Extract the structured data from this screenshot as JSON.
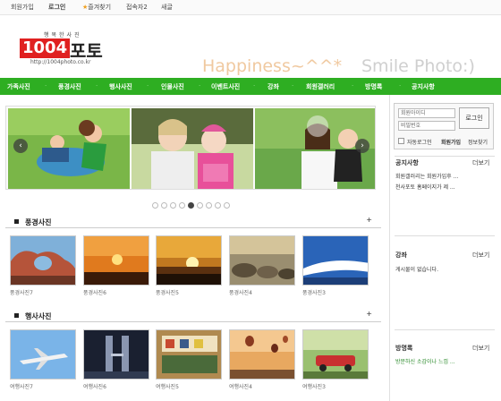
{
  "topbar": {
    "join": "회원가입",
    "login": "로그인",
    "favorites": "즐겨찾기",
    "visitors": "접속자2",
    "menu": "새글"
  },
  "header": {
    "logo_sub": "행복한사진",
    "logo_num": "1004",
    "logo_ko": "포토",
    "logo_url": "http://1004photo.co.kr",
    "slogan1": "Happiness~^^*",
    "slogan2": "Smile Photo:)"
  },
  "nav": [
    "가족사진",
    "풍경사진",
    "행사사진",
    "인물사진",
    "이벤트사진",
    "강좌",
    "회원갤러리",
    "방명록",
    "공지사항"
  ],
  "slider": {
    "prev": "‹",
    "next": "›",
    "dot_count": 9,
    "active_dot": 4
  },
  "sections": {
    "landscape": {
      "title": "풍경사진",
      "more": "+",
      "items": [
        "풍경사진7",
        "풍경사진6",
        "풍경사진5",
        "풍경사진4",
        "풍경사진3"
      ]
    },
    "event": {
      "title": "행사사진",
      "more": "+",
      "items": [
        "여행사진7",
        "여행사진6",
        "여행사진5",
        "여행사진4",
        "여행사진3"
      ]
    }
  },
  "sidebar": {
    "login": {
      "id_placeholder": "회원아이디",
      "pw_placeholder": "비밀번호",
      "button": "로그인",
      "autologin": "자동로그인",
      "join": "회원가입",
      "find": "정보찾기"
    },
    "notice": {
      "title": "공지사항",
      "more": "더보기",
      "items": [
        "회원갤러리는 회원가입후 ...",
        "천사포토 홈페이지가 제 ..."
      ]
    },
    "lecture": {
      "title": "강좌",
      "more": "더보기",
      "empty": "게시물이 없습니다."
    },
    "guestbook": {
      "title": "방명록",
      "more": "더보기",
      "items": [
        "방문하신 소감이나 느낌 ..."
      ]
    }
  },
  "colors": {
    "nav_green": "#2eae22",
    "logo_red": "#e02020"
  }
}
